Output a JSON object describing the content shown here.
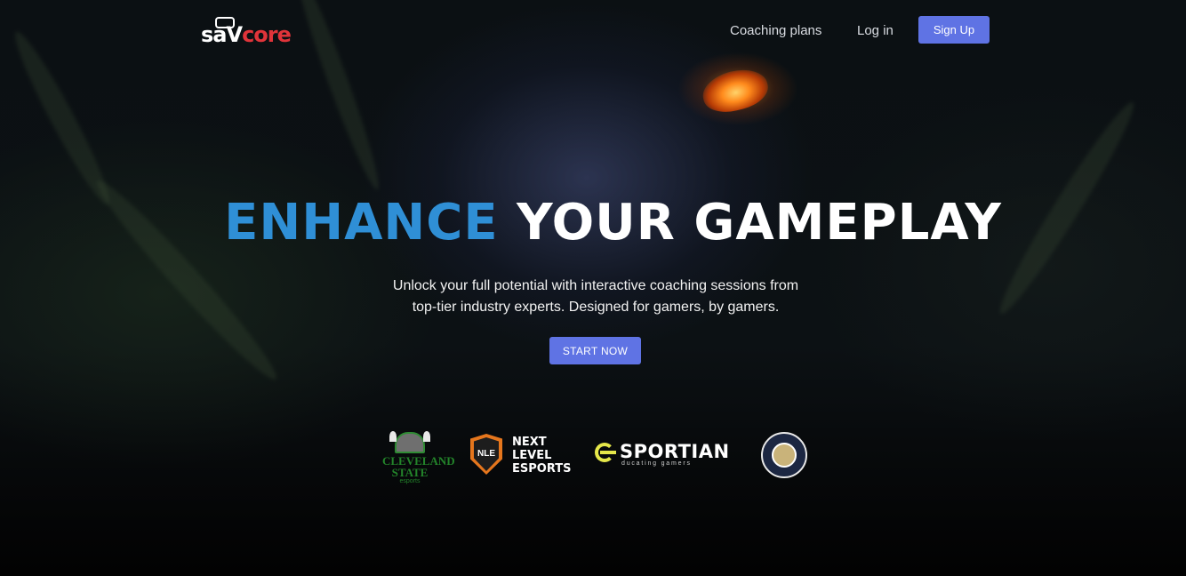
{
  "brand": {
    "logo_text_white": "sa",
    "logo_text_white2": "V",
    "logo_text_red": "core"
  },
  "nav": {
    "coaching_plans": "Coaching plans",
    "log_in": "Log in",
    "sign_up": "Sign Up"
  },
  "hero": {
    "headline_accent": "ENHANCE",
    "headline_rest": "YOUR GAMEPLAY",
    "subtext_line1": "Unlock your full potential with interactive coaching sessions from",
    "subtext_line2": "top-tier industry experts. Designed for gamers, by gamers.",
    "cta": "START NOW"
  },
  "partners": {
    "cleveland": {
      "name": "CLEVELAND STATE",
      "sub": "esports"
    },
    "nle": {
      "badge": "NLE",
      "line1": "NEXT",
      "line2": "LEVEL",
      "line3": "ESPORTS"
    },
    "esportian": {
      "name": "SPORTIAN",
      "tagline": "ducating gamers"
    }
  },
  "colors": {
    "accent_blue": "#2f8fd6",
    "button": "#5f73e4",
    "brand_red": "#e0343a",
    "nle_orange": "#e5761d",
    "esportian_yellow": "#e5e74a",
    "cleveland_green": "#23842a"
  }
}
